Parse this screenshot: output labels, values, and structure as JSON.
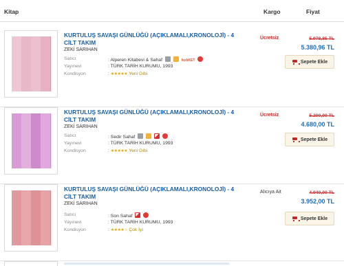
{
  "header": {
    "book": "Kitap",
    "cargo": "Kargo",
    "price": "Fiyat"
  },
  "labels": {
    "seller": "Satıcı",
    "publisher": "Yayınevi",
    "condition": "Kondisyon"
  },
  "button_label": "Sepete Ekle",
  "items": [
    {
      "title": "KURTULUŞ SAVAŞI GÜNLÜĞÜ (AÇIKLAMALI,KRONOLOJİ) - 4 CİLT TAKIM",
      "author": "ZEKİ SARIHAN",
      "seller": "Alperen Kitabevi & Sahaf",
      "publisher": "TÜRK TARİH KURUMU, 1993",
      "stars": "★★★★★",
      "condition": "Yeni Gibi",
      "cargo": "Ücretsiz",
      "old_price": "5.978,85 TL",
      "new_price": "5.380,96 TL",
      "badge_text": "hızlıKET"
    },
    {
      "title": "KURTULUŞ SAVAŞI GÜNLÜĞÜ (AÇIKLAMALI,KRONOLOJİ) - 4 CİLT TAKIM",
      "author": "ZEKİ SARIHAN",
      "seller": "Sedir Sahaf",
      "publisher": "TÜRK TARİH KURUMU, 1993",
      "stars": "★★★★★",
      "condition": "Yeni Gibi",
      "cargo": "Ücretsiz",
      "old_price": "5.200,00 TL",
      "new_price": "4.680,00 TL"
    },
    {
      "title": "KURTULUŞ SAVAŞI GÜNLÜĞÜ (AÇIKLAMALI,KRONOLOJİ) - 4 CİLT TAKIM",
      "author": "ZEKİ SARIHAN",
      "seller": "Son Sahaf",
      "publisher": "TÜRK TARİH KURUMU, 1993",
      "stars": "★★★★☆",
      "condition": "Çok İyi",
      "cargo": "Alıcıya Ait",
      "old_price": "4.940,00 TL",
      "new_price": "3.952,00 TL"
    }
  ],
  "colors": {
    "title_link": "#1a5ea3",
    "price": "#1a6fba",
    "old_price": "#d32f2f",
    "free_shipping": "#c62828",
    "stars": "#e6a200"
  }
}
